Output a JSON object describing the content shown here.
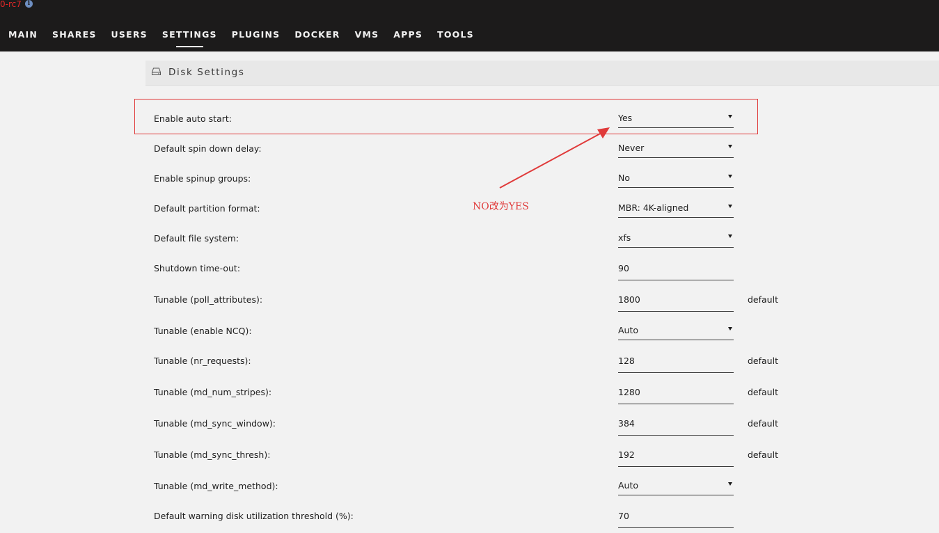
{
  "header": {
    "version_text": "0-rc7",
    "nav": [
      {
        "label": "MAIN"
      },
      {
        "label": "SHARES"
      },
      {
        "label": "USERS"
      },
      {
        "label": "SETTINGS"
      },
      {
        "label": "PLUGINS"
      },
      {
        "label": "DOCKER"
      },
      {
        "label": "VMS"
      },
      {
        "label": "APPS"
      },
      {
        "label": "TOOLS"
      }
    ],
    "active_tab": "SETTINGS"
  },
  "page": {
    "title": "Disk Settings"
  },
  "annotation": {
    "text": "NO改为YES",
    "color": "#e03a3a"
  },
  "settings": [
    {
      "label": "Enable auto start:",
      "value": "Yes",
      "type": "select"
    },
    {
      "label": "Default spin down delay:",
      "value": "Never",
      "type": "select"
    },
    {
      "label": "Enable spinup groups:",
      "value": "No",
      "type": "select"
    },
    {
      "label": "Default partition format:",
      "value": "MBR: 4K-aligned",
      "type": "select"
    },
    {
      "label": "Default file system:",
      "value": "xfs",
      "type": "select"
    },
    {
      "label": "Shutdown time-out:",
      "value": "90",
      "type": "input"
    },
    {
      "label": "Tunable (poll_attributes):",
      "value": "1800",
      "type": "input",
      "note": "default"
    },
    {
      "label": "Tunable (enable NCQ):",
      "value": "Auto",
      "type": "select"
    },
    {
      "label": "Tunable (nr_requests):",
      "value": "128",
      "type": "input",
      "note": "default"
    },
    {
      "label": "Tunable (md_num_stripes):",
      "value": "1280",
      "type": "input",
      "note": "default"
    },
    {
      "label": "Tunable (md_sync_window):",
      "value": "384",
      "type": "input",
      "note": "default"
    },
    {
      "label": "Tunable (md_sync_thresh):",
      "value": "192",
      "type": "input",
      "note": "default"
    },
    {
      "label": "Tunable (md_write_method):",
      "value": "Auto",
      "type": "select"
    },
    {
      "label": "Default warning disk utilization threshold (%):",
      "value": "70",
      "type": "input"
    }
  ]
}
